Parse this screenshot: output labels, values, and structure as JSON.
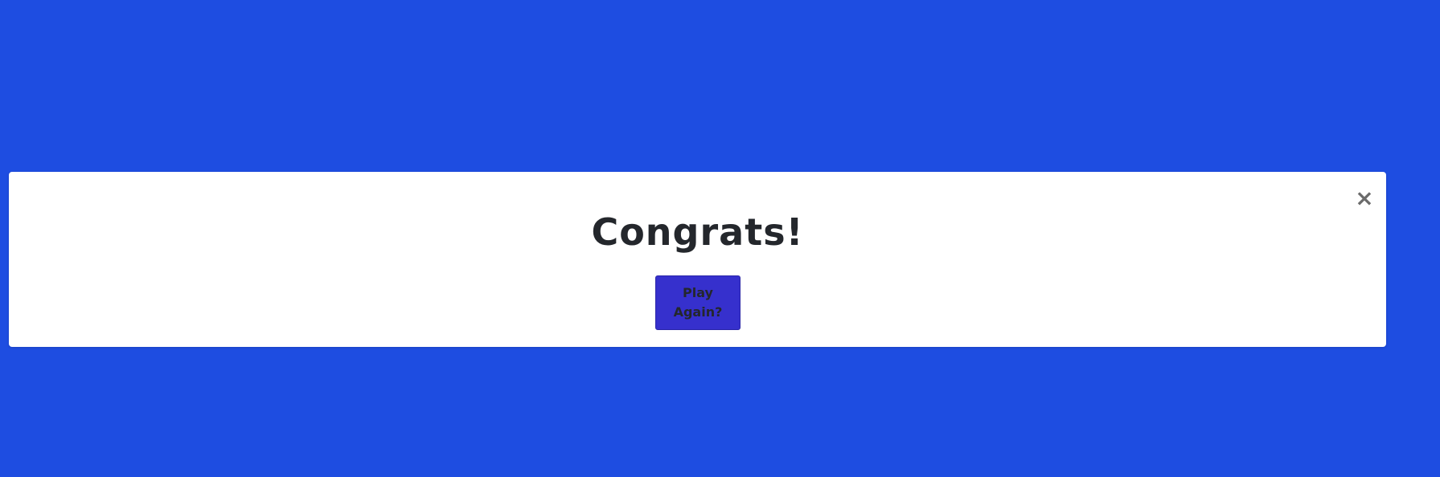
{
  "colors": {
    "background": "#1e4de1",
    "modal_background": "#ffffff",
    "button_background": "#3630cd",
    "text": "#24272c",
    "close_icon": "#6b6b6b"
  },
  "modal": {
    "title": "Congrats!",
    "close_icon": "×",
    "play_again_label": "Play Again?"
  }
}
